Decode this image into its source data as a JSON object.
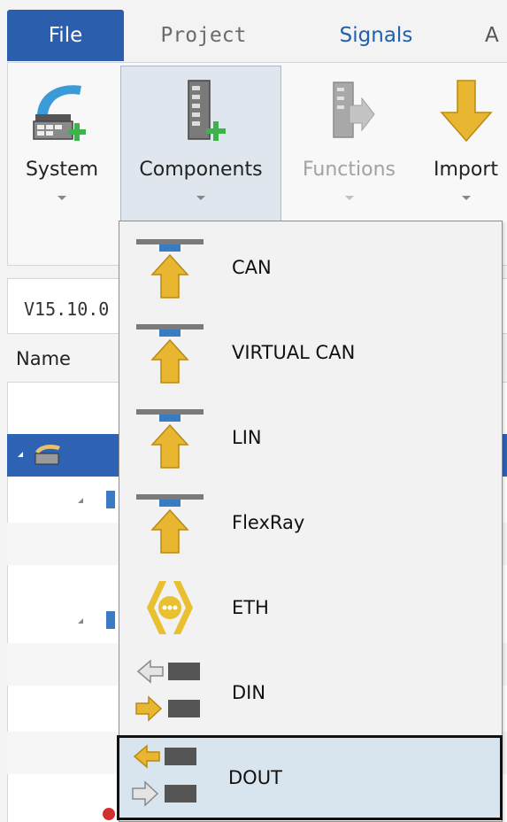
{
  "tabs": [
    {
      "label": "File",
      "active": true
    },
    {
      "label": "Project"
    },
    {
      "label": "Signals"
    },
    {
      "label": "A"
    }
  ],
  "ribbon": {
    "system": {
      "label": "System",
      "icon": "system-add-icon"
    },
    "components": {
      "label": "Components",
      "icon": "component-add-icon",
      "pressed": true
    },
    "functions": {
      "label": "Functions",
      "icon": "function-arrow-icon",
      "disabled": true
    },
    "import": {
      "label": "Import",
      "icon": "import-arrow-icon"
    }
  },
  "tree": {
    "version": "V15.10.0",
    "header": "Name"
  },
  "menu": {
    "items": [
      {
        "label": "CAN",
        "icon": "can-bus-icon"
      },
      {
        "label": "VIRTUAL CAN",
        "icon": "virtual-can-bus-icon"
      },
      {
        "label": "LIN",
        "icon": "lin-bus-icon"
      },
      {
        "label": "FlexRay",
        "icon": "flexray-bus-icon"
      },
      {
        "label": "ETH",
        "icon": "ethernet-icon"
      },
      {
        "label": "DIN",
        "icon": "digital-input-icon"
      },
      {
        "label": "DOUT",
        "icon": "digital-output-icon",
        "hovered": true
      }
    ]
  },
  "colors": {
    "file_tab": "#2b5fad",
    "signals_tab": "#1f5fae",
    "selection": "#2e63b3",
    "hover": "#d8e4ee",
    "arrow_gold": "#e8b630",
    "bus_blue": "#3a7cc4",
    "plus_green": "#3cb44b"
  }
}
